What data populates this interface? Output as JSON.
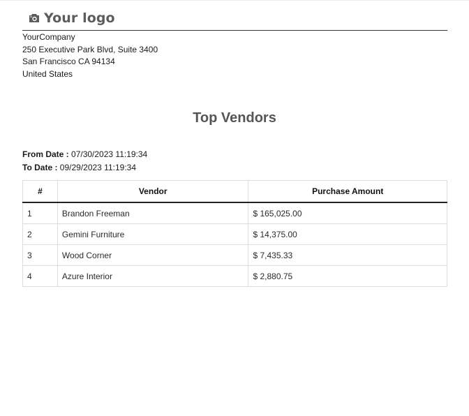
{
  "header": {
    "logo_text": "Your logo",
    "logo_icon": "camera-icon"
  },
  "company": {
    "name": "YourCompany",
    "street": "250 Executive Park Blvd, Suite 3400",
    "city": "San Francisco CA 94134",
    "country": "United States"
  },
  "report": {
    "title": "Top Vendors",
    "from_label": "From Date :",
    "from_value": " 07/30/2023 11:19:34",
    "to_label": "To Date :",
    "to_value": " 09/29/2023 11:19:34"
  },
  "table": {
    "headers": [
      "#",
      "Vendor",
      "Purchase Amount"
    ],
    "rows": [
      [
        "1",
        "Brandon Freeman",
        "$ 165,025.00"
      ],
      [
        "2",
        "Gemini Furniture",
        "$ 14,375.00"
      ],
      [
        "3",
        "Wood Corner",
        "$ 7,435.33"
      ],
      [
        "4",
        "Azure Interior",
        "$ 2,880.75"
      ]
    ]
  }
}
